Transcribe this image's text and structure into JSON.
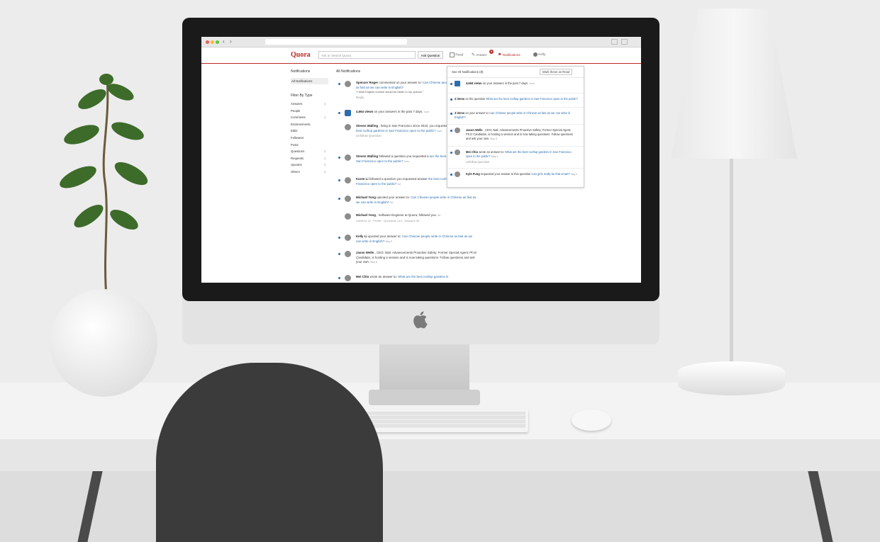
{
  "browser": {
    "window_buttons": [
      "#ee5d54",
      "#f6be30",
      "#5ec640"
    ],
    "back": "‹",
    "forward": "›"
  },
  "quora": {
    "logo": "Quora",
    "search_placeholder": "Ask or Search Quora",
    "ask_button": "Ask Question",
    "nav": {
      "read": "Read",
      "answer": "Answer",
      "answer_badge": "8",
      "notifications": "Notifications",
      "profile": "Kelly"
    },
    "accent_color": "#b92b27"
  },
  "sidebar": {
    "title": "Notifications",
    "all": "All Notifications",
    "filter_title": "Filter By Type",
    "types": [
      {
        "label": "Answers",
        "count": "1"
      },
      {
        "label": "People",
        "count": ""
      },
      {
        "label": "Comments",
        "count": "1"
      },
      {
        "label": "Endorsements",
        "count": ""
      },
      {
        "label": "Edits",
        "count": ""
      },
      {
        "label": "Followers",
        "count": ""
      },
      {
        "label": "Posts",
        "count": ""
      },
      {
        "label": "Questions",
        "count": "2"
      },
      {
        "label": "Requests",
        "count": "1"
      },
      {
        "label": "Upvotes",
        "count": "2"
      },
      {
        "label": "Others",
        "count": "2"
      }
    ]
  },
  "feed": {
    "title": "All Notifications",
    "items": [
      {
        "name": "Spencer Roger",
        "text": "commented on your answer to:",
        "link": "Can Chinese people write in Chinese as fast as we can write in English?",
        "quote": "\"I think English cursive would be faster in my opinion.\"",
        "action": "Reply"
      },
      {
        "name": "4,664 views",
        "text": "on your answers in the past 7 days.",
        "time": "1wm"
      },
      {
        "name": "Steven Walling",
        "text": ", living in San Francisco since 2010, you requested to:",
        "link": "What are the best rooftop gardens in San Francisco open to the public?",
        "time": "1wm",
        "action": "Unfollow Question"
      },
      {
        "name": "Steven Walling",
        "text": "followed a question you requested a",
        "link": "are the best rooftop gardens in San Francisco open to the public?",
        "time": "1wm"
      },
      {
        "name": "Karen Li",
        "text": "followed a question you requested answer",
        "link": "the best rooftop gardens in San Francisco open to the public?",
        "time": "5d"
      },
      {
        "name": "Michael Yong",
        "text": "upvoted your answer to:",
        "link": "Can Chinese people write in Chinese as fast as we can write in English?",
        "time": "5d"
      },
      {
        "name": "Michael Yong",
        "text": ", Software Engineer at Quora, followed you.",
        "time": "5d",
        "stats": "Unfollow 1k · Profile · Questions 213 · Answers 36"
      },
      {
        "name": "Kelly Li",
        "text": "upvoted your answer to:",
        "link": "Can Chinese people write in Chinese as fast as we can write in English?",
        "time": "May 5"
      },
      {
        "name": "Jason Wells",
        "text": ", CEO; Natl. Advancements Proactive Safety; Former Special Agent; Ph.D Candidate, is hosting a session and is now taking questions. Follow questions and ask your own.",
        "time": "May 5"
      },
      {
        "name": "Mei Chiu",
        "text": "wrote an answer to:",
        "link": "What are the best rooftop gardens in"
      }
    ]
  },
  "dropdown": {
    "see_all": "See All Notifications (8)",
    "mark_read": "Mark these as Read",
    "items": [
      {
        "bold": "4,664 views",
        "text": "on your answers in the past 7 days.",
        "time": "1wm"
      },
      {
        "bold": "2 items",
        "text": "on the question",
        "link": "What are the best rooftop gardens in San Francisco open to the public?"
      },
      {
        "bold": "3 items",
        "text": "on your answer to",
        "link": "Can Chinese people write in Chinese as fast as we can write in English?"
      },
      {
        "bold": "Jason Wells",
        "text": ", CEO; Natl. Advancements Proactive Safety; Former Special Agent; Ph.D Candidate, is hosting a session and is now taking questions. Follow questions and ask your own.",
        "time": "May 5"
      },
      {
        "bold": "Mei Chiu",
        "text": "wrote an answer to:",
        "link": "What are the best rooftop gardens in San Francisco open to the public?",
        "time": "May 4",
        "action": "Unfollow Question"
      },
      {
        "bold": "Kyle Fung",
        "text": "requested your answer to this question",
        "link": "Can girls really be that smart?",
        "time": "May 4"
      }
    ]
  }
}
